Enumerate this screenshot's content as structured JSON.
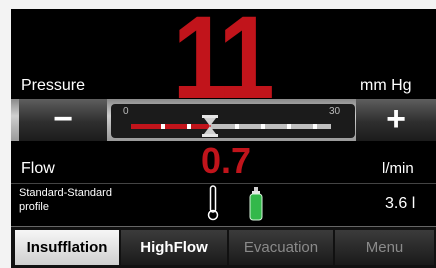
{
  "pressure": {
    "value": "11",
    "label": "Pressure",
    "unit": "mm Hg",
    "slider_min": "0",
    "slider_max": "30",
    "slider_set": 11,
    "minus_label": "−",
    "plus_label": "+"
  },
  "flow": {
    "label": "Flow",
    "value": "0.7",
    "unit": "l/min"
  },
  "profile": {
    "line1": "Standard-Standard",
    "line2": "profile",
    "volume": "3.6 l"
  },
  "tabs": [
    {
      "label": "Insufflation"
    },
    {
      "label": "HighFlow"
    },
    {
      "label": "Evacuation"
    },
    {
      "label": "Menu"
    }
  ],
  "colors": {
    "accent_red": "#c1141b",
    "green_cylinder": "#33b84a"
  },
  "icons": [
    "hourglass-icon",
    "thermometer-icon",
    "gas-cylinder-icon"
  ]
}
